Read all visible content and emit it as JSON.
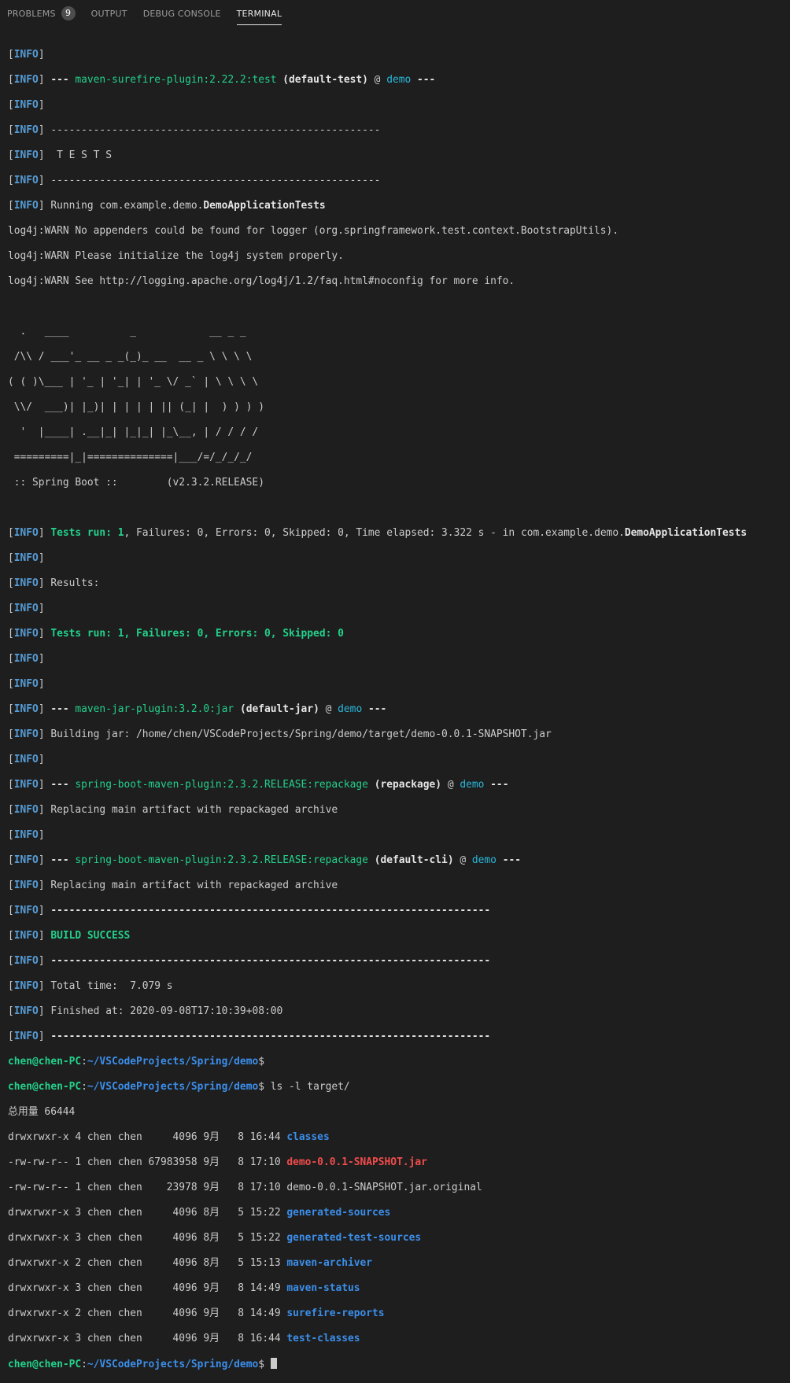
{
  "tabs": [
    {
      "label": "PROBLEMS",
      "badge": "9"
    },
    {
      "label": "OUTPUT"
    },
    {
      "label": "DEBUG CONSOLE"
    },
    {
      "label": "TERMINAL"
    }
  ],
  "terminal": {
    "info_tag": "INFO",
    "dashes_short": "------------------------------------------------------",
    "dashes_long": "------------------------------------------------------------------------",
    "surefire_plugin": "maven-surefire-plugin:2.22.2:test",
    "default_test": "(default-test)",
    "project": "demo",
    "tests_header": " T E S T S",
    "running_prefix": "Running com.example.demo.",
    "running_class": "DemoApplicationTests",
    "log4j_1": "log4j:WARN No appenders could be found for logger (org.springframework.test.context.BootstrapUtils).",
    "log4j_2": "log4j:WARN Please initialize the log4j system properly.",
    "log4j_3": "log4j:WARN See http://logging.apache.org/log4j/1.2/faq.html#noconfig for more info.",
    "banner": [
      "  .   ____          _            __ _ _",
      " /\\\\ / ___'_ __ _ _(_)_ __  __ _ \\ \\ \\ \\",
      "( ( )\\___ | '_ | '_| | '_ \\/ _` | \\ \\ \\ \\",
      " \\\\/  ___)| |_)| | | | | || (_| |  ) ) ) )",
      "  '  |____| .__|_| |_|_| |_\\__, | / / / /",
      " =========|_|==============|___/=/_/_/_/",
      " :: Spring Boot ::        (v2.3.2.RELEASE)"
    ],
    "tests_run_1": "Tests run: 1",
    "tests_rest": ", Failures: 0, Errors: 0, Skipped: 0, Time elapsed: 3.322 s - in com.example.demo.",
    "results": "Results:",
    "tests_summary": "Tests run: 1, Failures: 0, Errors: 0, Skipped: 0",
    "jar_plugin": "maven-jar-plugin:3.2.0:jar",
    "default_jar": "(default-jar)",
    "building_jar": "Building jar: /home/chen/VSCodeProjects/Spring/demo/target/demo-0.0.1-SNAPSHOT.jar",
    "boot_plugin": "spring-boot-maven-plugin:2.3.2.RELEASE:repackage",
    "repackage_id": "(repackage)",
    "replacing": "Replacing main artifact with repackaged archive",
    "default_cli": "(default-cli)",
    "build_success": "BUILD SUCCESS",
    "total_time": "Total time:  7.079 s",
    "finished_at": "Finished at: 2020-09-08T17:10:39+08:00",
    "prompt_user": "chen@chen-PC",
    "prompt_path": "~/VSCodeProjects/Spring/demo",
    "command": " ls -l target/",
    "total": "总用量 66444",
    "files": [
      {
        "meta": "drwxrwxr-x 4 chen chen     4096 9月   8 16:44 ",
        "name": "classes",
        "kind": "dir"
      },
      {
        "meta": "-rw-rw-r-- 1 chen chen 67983958 9月   8 17:10 ",
        "name": "demo-0.0.1-SNAPSHOT.jar",
        "kind": "archive"
      },
      {
        "meta": "-rw-rw-r-- 1 chen chen    23978 9月   8 17:10 ",
        "name": "demo-0.0.1-SNAPSHOT.jar.original",
        "kind": "file"
      },
      {
        "meta": "drwxrwxr-x 3 chen chen     4096 8月   5 15:22 ",
        "name": "generated-sources",
        "kind": "dir"
      },
      {
        "meta": "drwxrwxr-x 3 chen chen     4096 8月   5 15:22 ",
        "name": "generated-test-sources",
        "kind": "dir"
      },
      {
        "meta": "drwxrwxr-x 2 chen chen     4096 8月   5 15:13 ",
        "name": "maven-archiver",
        "kind": "dir"
      },
      {
        "meta": "drwxrwxr-x 3 chen chen     4096 9月   8 14:49 ",
        "name": "maven-status",
        "kind": "dir"
      },
      {
        "meta": "drwxrwxr-x 2 chen chen     4096 9月   8 14:49 ",
        "name": "surefire-reports",
        "kind": "dir"
      },
      {
        "meta": "drwxrwxr-x 3 chen chen     4096 9月   8 16:44 ",
        "name": "test-classes",
        "kind": "dir"
      }
    ]
  }
}
